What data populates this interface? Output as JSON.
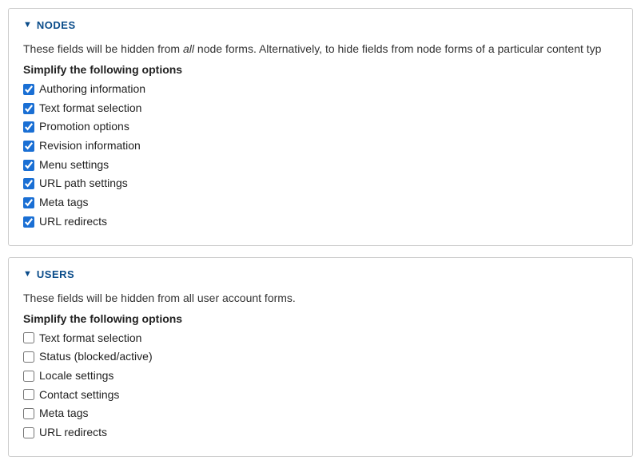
{
  "sections": {
    "nodes": {
      "title": "NODES",
      "desc_pre": "These fields will be hidden from ",
      "desc_em": "all",
      "desc_post": " node forms. Alternatively, to hide fields from node forms of a particular content typ",
      "subhead": "Simplify the following options",
      "options": [
        {
          "key": "authoring-information",
          "label": "Authoring information",
          "checked": true
        },
        {
          "key": "text-format-selection",
          "label": "Text format selection",
          "checked": true
        },
        {
          "key": "promotion-options",
          "label": "Promotion options",
          "checked": true
        },
        {
          "key": "revision-information",
          "label": "Revision information",
          "checked": true
        },
        {
          "key": "menu-settings",
          "label": "Menu settings",
          "checked": true
        },
        {
          "key": "url-path-settings",
          "label": "URL path settings",
          "checked": true
        },
        {
          "key": "meta-tags",
          "label": "Meta tags",
          "checked": true
        },
        {
          "key": "url-redirects",
          "label": "URL redirects",
          "checked": true
        }
      ]
    },
    "users": {
      "title": "USERS",
      "desc": "These fields will be hidden from all user account forms.",
      "subhead": "Simplify the following options",
      "options": [
        {
          "key": "text-format-selection",
          "label": "Text format selection",
          "checked": false
        },
        {
          "key": "status-blocked-active",
          "label": "Status (blocked/active)",
          "checked": false
        },
        {
          "key": "locale-settings",
          "label": "Locale settings",
          "checked": false
        },
        {
          "key": "contact-settings",
          "label": "Contact settings",
          "checked": false
        },
        {
          "key": "meta-tags",
          "label": "Meta tags",
          "checked": false
        },
        {
          "key": "url-redirects",
          "label": "URL redirects",
          "checked": false
        }
      ]
    }
  }
}
